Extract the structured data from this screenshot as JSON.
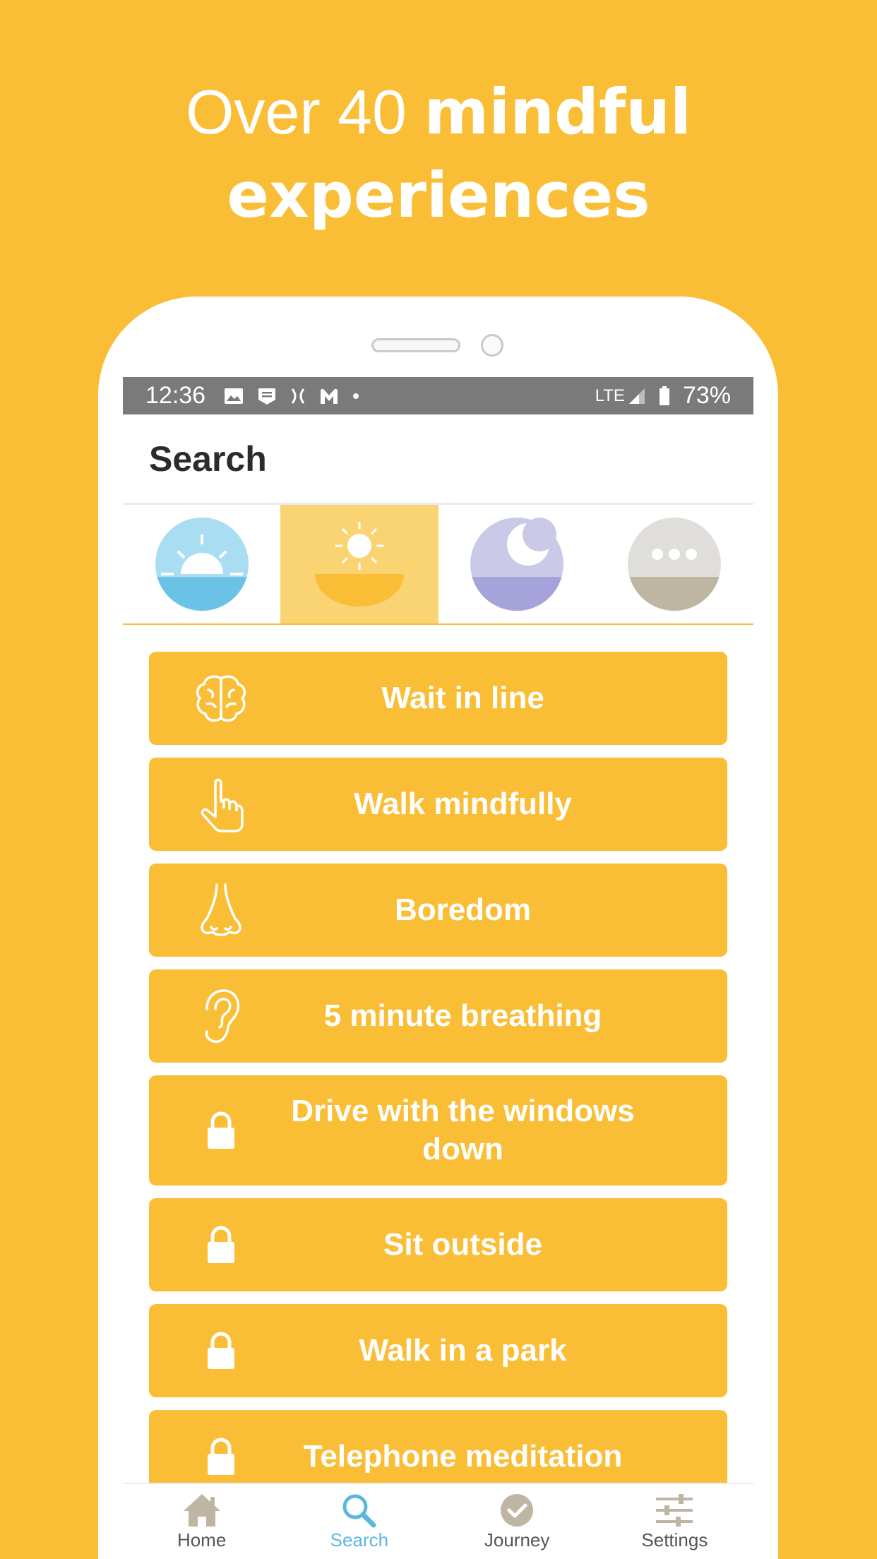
{
  "headline": {
    "light": "Over 40 ",
    "bold": "mindful experiences"
  },
  "statusbar": {
    "time": "12:36",
    "network": "LTE",
    "battery": "73%"
  },
  "appbar": {
    "title": "Search"
  },
  "tabs": [
    {
      "name": "morning",
      "icon": "sunrise-icon",
      "active": false
    },
    {
      "name": "day",
      "icon": "sun-icon",
      "active": true
    },
    {
      "name": "night",
      "icon": "moon-icon",
      "active": false
    },
    {
      "name": "other",
      "icon": "more-icon",
      "active": false
    }
  ],
  "items": [
    {
      "label": "Wait in line",
      "icon": "brain-icon",
      "locked": false
    },
    {
      "label": "Walk mindfully",
      "icon": "pointing-hand-icon",
      "locked": false
    },
    {
      "label": "Boredom",
      "icon": "nose-icon",
      "locked": false
    },
    {
      "label": "5 minute breathing",
      "icon": "ear-icon",
      "locked": false
    },
    {
      "label": "Drive with the windows down",
      "icon": "lock-icon",
      "locked": true
    },
    {
      "label": "Sit outside",
      "icon": "lock-icon",
      "locked": true
    },
    {
      "label": "Walk in a park",
      "icon": "lock-icon",
      "locked": true
    },
    {
      "label": "Telephone meditation",
      "icon": "lock-icon",
      "locked": true
    }
  ],
  "nav": [
    {
      "label": "Home",
      "icon": "home-icon",
      "active": false
    },
    {
      "label": "Search",
      "icon": "search-icon",
      "active": true
    },
    {
      "label": "Journey",
      "icon": "check-circle-icon",
      "active": false
    },
    {
      "label": "Settings",
      "icon": "sliders-icon",
      "active": false
    }
  ],
  "colors": {
    "background": "#F9BE36",
    "active_tab": "#FAD373",
    "nav_active": "#5BB7E0"
  }
}
